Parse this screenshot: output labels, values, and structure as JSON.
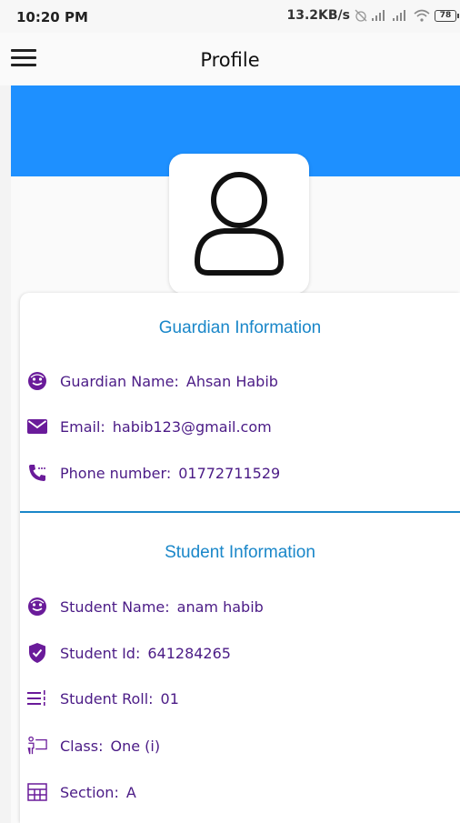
{
  "status_bar": {
    "time": "10:20 PM",
    "net_speed": "13.2KB/s",
    "battery": "78"
  },
  "app_bar": {
    "title": "Profile"
  },
  "guardian": {
    "section_title": "Guardian Information",
    "name_label": "Guardian Name:",
    "name_value": "Ahsan Habib",
    "email_label": "Email:",
    "email_value": "habib123@gmail.com",
    "phone_label": "Phone number:",
    "phone_value": "01772711529"
  },
  "student": {
    "section_title": "Student Information",
    "name_label": "Student Name:",
    "name_value": "anam habib",
    "id_label": "Student Id:",
    "id_value": "641284265",
    "roll_label": "Student Roll:",
    "roll_value": "01",
    "class_label": "Class:",
    "class_value": "One (i)",
    "section_label": "Section:",
    "section_value": "A"
  },
  "colors": {
    "banner": "#1e90ff",
    "section_title": "#1a87c9",
    "text": "#4b1b86",
    "icon": "#6a1b9a"
  },
  "icons": {
    "guardian_name": "face-icon",
    "email": "mail-icon",
    "phone": "phone-icon",
    "student_name": "face-icon",
    "student_id": "shield-check-icon",
    "student_roll": "list-numbered-icon",
    "class": "classroom-icon",
    "section": "table-grid-icon"
  }
}
